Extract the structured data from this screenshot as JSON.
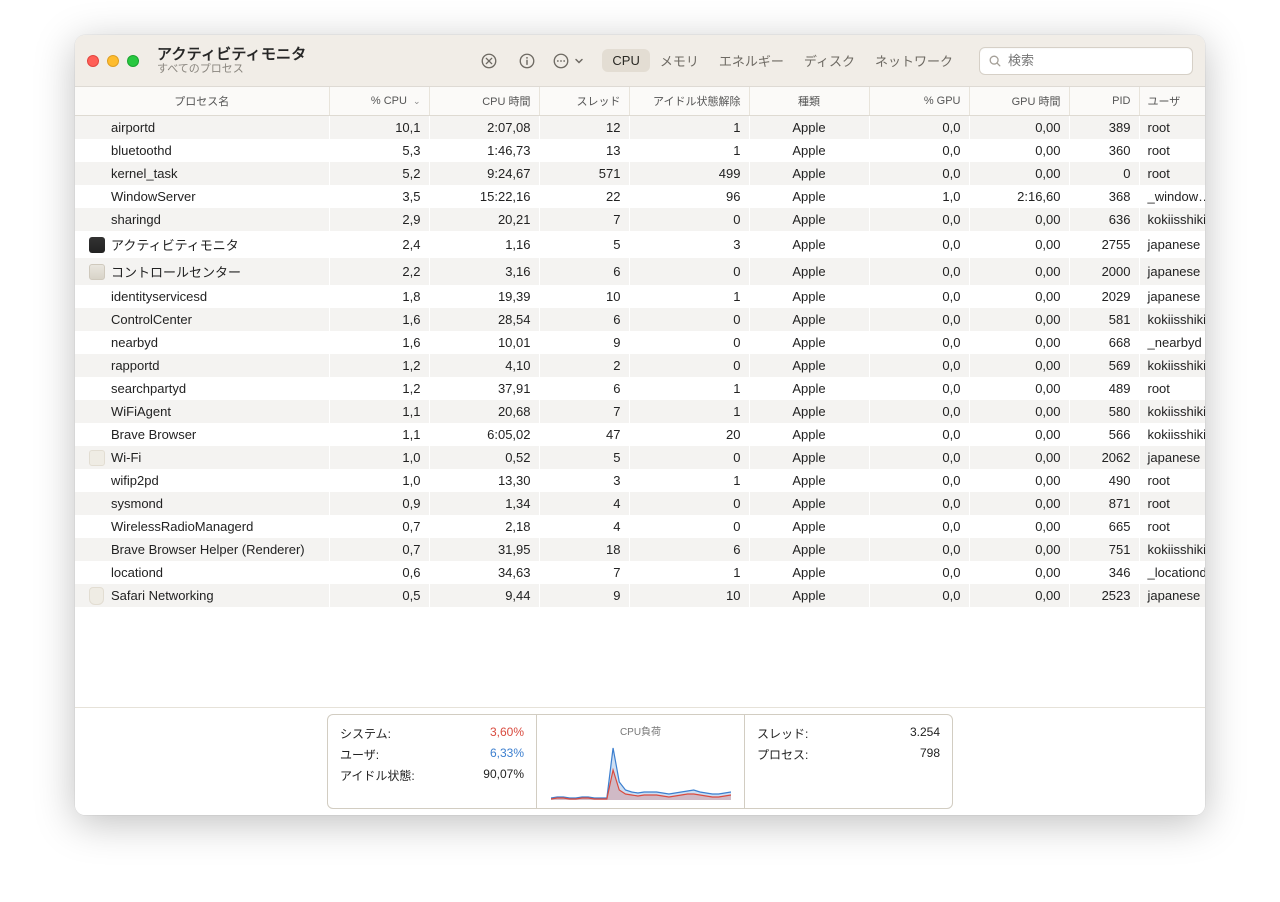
{
  "window": {
    "title": "アクティビティモニタ",
    "subtitle": "すべてのプロセス"
  },
  "toolbar": {
    "tabs": {
      "cpu": "CPU",
      "memory": "メモリ",
      "energy": "エネルギー",
      "disk": "ディスク",
      "network": "ネットワーク"
    },
    "search_placeholder": "検索"
  },
  "columns": {
    "name": "プロセス名",
    "cpu": "% CPU",
    "cpu_time": "CPU 時間",
    "threads": "スレッド",
    "idle_wake": "アイドル状態解除",
    "kind": "種類",
    "gpu": "% GPU",
    "gpu_time": "GPU 時間",
    "pid": "PID",
    "user": "ユーザ"
  },
  "processes": [
    {
      "icon": "",
      "name": "airportd",
      "cpu": "10,1",
      "cpu_time": "2:07,08",
      "threads": "12",
      "idle_wake": "1",
      "kind": "Apple",
      "gpu": "0,0",
      "gpu_time": "0,00",
      "pid": "389",
      "user": "root"
    },
    {
      "icon": "",
      "name": "bluetoothd",
      "cpu": "5,3",
      "cpu_time": "1:46,73",
      "threads": "13",
      "idle_wake": "1",
      "kind": "Apple",
      "gpu": "0,0",
      "gpu_time": "0,00",
      "pid": "360",
      "user": "root"
    },
    {
      "icon": "",
      "name": "kernel_task",
      "cpu": "5,2",
      "cpu_time": "9:24,67",
      "threads": "571",
      "idle_wake": "499",
      "kind": "Apple",
      "gpu": "0,0",
      "gpu_time": "0,00",
      "pid": "0",
      "user": "root"
    },
    {
      "icon": "",
      "name": "WindowServer",
      "cpu": "3,5",
      "cpu_time": "15:22,16",
      "threads": "22",
      "idle_wake": "96",
      "kind": "Apple",
      "gpu": "1,0",
      "gpu_time": "2:16,60",
      "pid": "368",
      "user": "_windowserv"
    },
    {
      "icon": "",
      "name": "sharingd",
      "cpu": "2,9",
      "cpu_time": "20,21",
      "threads": "7",
      "idle_wake": "0",
      "kind": "Apple",
      "gpu": "0,0",
      "gpu_time": "0,00",
      "pid": "636",
      "user": "kokiisshiki"
    },
    {
      "icon": "activity",
      "name": "アクティビティモニタ",
      "cpu": "2,4",
      "cpu_time": "1,16",
      "threads": "5",
      "idle_wake": "3",
      "kind": "Apple",
      "gpu": "0,0",
      "gpu_time": "0,00",
      "pid": "2755",
      "user": "japanese"
    },
    {
      "icon": "cc",
      "name": "コントロールセンター",
      "cpu": "2,2",
      "cpu_time": "3,16",
      "threads": "6",
      "idle_wake": "0",
      "kind": "Apple",
      "gpu": "0,0",
      "gpu_time": "0,00",
      "pid": "2000",
      "user": "japanese"
    },
    {
      "icon": "",
      "name": "identityservicesd",
      "cpu": "1,8",
      "cpu_time": "19,39",
      "threads": "10",
      "idle_wake": "1",
      "kind": "Apple",
      "gpu": "0,0",
      "gpu_time": "0,00",
      "pid": "2029",
      "user": "japanese"
    },
    {
      "icon": "",
      "name": "ControlCenter",
      "cpu": "1,6",
      "cpu_time": "28,54",
      "threads": "6",
      "idle_wake": "0",
      "kind": "Apple",
      "gpu": "0,0",
      "gpu_time": "0,00",
      "pid": "581",
      "user": "kokiisshiki"
    },
    {
      "icon": "",
      "name": "nearbyd",
      "cpu": "1,6",
      "cpu_time": "10,01",
      "threads": "9",
      "idle_wake": "0",
      "kind": "Apple",
      "gpu": "0,0",
      "gpu_time": "0,00",
      "pid": "668",
      "user": "_nearbyd"
    },
    {
      "icon": "",
      "name": "rapportd",
      "cpu": "1,2",
      "cpu_time": "4,10",
      "threads": "2",
      "idle_wake": "0",
      "kind": "Apple",
      "gpu": "0,0",
      "gpu_time": "0,00",
      "pid": "569",
      "user": "kokiisshiki"
    },
    {
      "icon": "",
      "name": "searchpartyd",
      "cpu": "1,2",
      "cpu_time": "37,91",
      "threads": "6",
      "idle_wake": "1",
      "kind": "Apple",
      "gpu": "0,0",
      "gpu_time": "0,00",
      "pid": "489",
      "user": "root"
    },
    {
      "icon": "",
      "name": "WiFiAgent",
      "cpu": "1,1",
      "cpu_time": "20,68",
      "threads": "7",
      "idle_wake": "1",
      "kind": "Apple",
      "gpu": "0,0",
      "gpu_time": "0,00",
      "pid": "580",
      "user": "kokiisshiki"
    },
    {
      "icon": "",
      "name": "Brave Browser",
      "cpu": "1,1",
      "cpu_time": "6:05,02",
      "threads": "47",
      "idle_wake": "20",
      "kind": "Apple",
      "gpu": "0,0",
      "gpu_time": "0,00",
      "pid": "566",
      "user": "kokiisshiki"
    },
    {
      "icon": "wifi",
      "name": "Wi-Fi",
      "cpu": "1,0",
      "cpu_time": "0,52",
      "threads": "5",
      "idle_wake": "0",
      "kind": "Apple",
      "gpu": "0,0",
      "gpu_time": "0,00",
      "pid": "2062",
      "user": "japanese"
    },
    {
      "icon": "",
      "name": "wifip2pd",
      "cpu": "1,0",
      "cpu_time": "13,30",
      "threads": "3",
      "idle_wake": "1",
      "kind": "Apple",
      "gpu": "0,0",
      "gpu_time": "0,00",
      "pid": "490",
      "user": "root"
    },
    {
      "icon": "",
      "name": "sysmond",
      "cpu": "0,9",
      "cpu_time": "1,34",
      "threads": "4",
      "idle_wake": "0",
      "kind": "Apple",
      "gpu": "0,0",
      "gpu_time": "0,00",
      "pid": "871",
      "user": "root"
    },
    {
      "icon": "",
      "name": "WirelessRadioManagerd",
      "cpu": "0,7",
      "cpu_time": "2,18",
      "threads": "4",
      "idle_wake": "0",
      "kind": "Apple",
      "gpu": "0,0",
      "gpu_time": "0,00",
      "pid": "665",
      "user": "root"
    },
    {
      "icon": "",
      "name": "Brave Browser Helper (Renderer)",
      "cpu": "0,7",
      "cpu_time": "31,95",
      "threads": "18",
      "idle_wake": "6",
      "kind": "Apple",
      "gpu": "0,0",
      "gpu_time": "0,00",
      "pid": "751",
      "user": "kokiisshiki"
    },
    {
      "icon": "",
      "name": "locationd",
      "cpu": "0,6",
      "cpu_time": "34,63",
      "threads": "7",
      "idle_wake": "1",
      "kind": "Apple",
      "gpu": "0,0",
      "gpu_time": "0,00",
      "pid": "346",
      "user": "_locationd"
    },
    {
      "icon": "safari",
      "name": "Safari Networking",
      "cpu": "0,5",
      "cpu_time": "9,44",
      "threads": "9",
      "idle_wake": "10",
      "kind": "Apple",
      "gpu": "0,0",
      "gpu_time": "0,00",
      "pid": "2523",
      "user": "japanese"
    }
  ],
  "stats": {
    "system_label": "システム:",
    "system_value": "3,60%",
    "user_label": "ユーザ:",
    "user_value": "6,33%",
    "idle_label": "アイドル状態:",
    "idle_value": "90,07%",
    "chart_title": "CPU負荷",
    "threads_label": "スレッド:",
    "threads_value": "3.254",
    "procs_label": "プロセス:",
    "procs_value": "798"
  },
  "chart_data": {
    "type": "area",
    "series": [
      {
        "name": "user",
        "color": "#3c7fcf",
        "values": [
          2,
          3,
          3,
          2,
          2,
          3,
          3,
          2,
          2,
          2,
          52,
          18,
          10,
          8,
          7,
          8,
          8,
          8,
          7,
          6,
          7,
          8,
          9,
          10,
          8,
          7,
          6,
          6,
          7,
          8
        ]
      },
      {
        "name": "system",
        "color": "#d94b3f",
        "values": [
          1,
          2,
          2,
          1,
          1,
          2,
          2,
          1,
          1,
          1,
          30,
          10,
          6,
          5,
          4,
          5,
          5,
          5,
          4,
          3,
          4,
          5,
          6,
          6,
          5,
          4,
          3,
          3,
          4,
          5
        ]
      }
    ],
    "ylim": [
      0,
      60
    ]
  }
}
